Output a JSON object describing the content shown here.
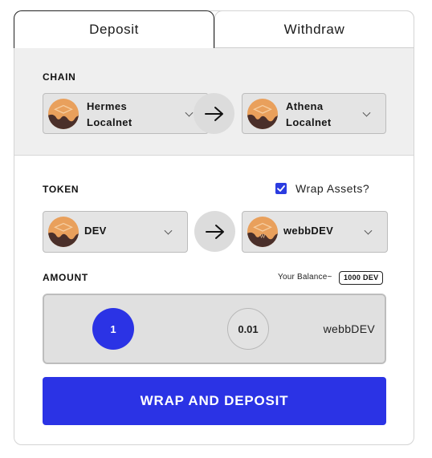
{
  "tabs": {
    "deposit": "Deposit",
    "withdraw": "Withdraw"
  },
  "chain": {
    "label": "CHAIN",
    "source": {
      "line1": "Hermes",
      "line2": "Localnet",
      "icon": "chain-logo-icon"
    },
    "destination": {
      "line1": "Athena",
      "line2": "Localnet",
      "icon": "chain-logo-icon"
    },
    "arrow_icon": "arrow-right-icon"
  },
  "token": {
    "label": "TOKEN",
    "wrap_assets": {
      "label": "Wrap Assets?",
      "checked": true
    },
    "source": {
      "name": "DEV",
      "icon": "token-logo-icon"
    },
    "destination": {
      "name": "webbDEV",
      "icon": "token-logo-icon"
    },
    "arrow_icon": "arrow-right-icon"
  },
  "amount": {
    "label": "AMOUNT",
    "balance_label": "Your Balance~",
    "balance_value": "1000 DEV",
    "options": [
      "1",
      "0.01"
    ],
    "selected": "1",
    "token": "webbDEV"
  },
  "submit_label": "WRAP AND DEPOSIT",
  "colors": {
    "accent": "#2b33e5",
    "panel": "#efefef",
    "logo_orange": "#e9a05c",
    "logo_brown": "#4a2f2a"
  }
}
